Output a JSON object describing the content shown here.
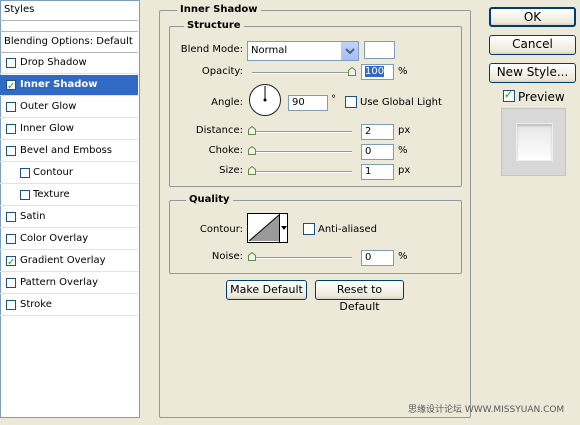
{
  "styles_panel": {
    "header": "Styles",
    "blending_options": "Blending Options: Default",
    "items": [
      {
        "label": "Drop Shadow",
        "checked": false
      },
      {
        "label": "Inner Shadow",
        "checked": true
      },
      {
        "label": "Outer Glow",
        "checked": false
      },
      {
        "label": "Inner Glow",
        "checked": false
      },
      {
        "label": "Bevel and Emboss",
        "checked": false
      },
      {
        "label": "Contour",
        "checked": false
      },
      {
        "label": "Texture",
        "checked": false
      },
      {
        "label": "Satin",
        "checked": false
      },
      {
        "label": "Color Overlay",
        "checked": false
      },
      {
        "label": "Gradient Overlay",
        "checked": true
      },
      {
        "label": "Pattern Overlay",
        "checked": false
      },
      {
        "label": "Stroke",
        "checked": false
      }
    ]
  },
  "inner_shadow": {
    "title": "Inner Shadow",
    "structure": {
      "title": "Structure",
      "blend_mode_label": "Blend Mode:",
      "blend_mode_value": "Normal",
      "opacity_label": "Opacity:",
      "opacity_value": "100",
      "opacity_unit": "%",
      "opacity_fraction": 1.0,
      "angle_label": "Angle:",
      "angle_value": "90",
      "angle_unit": "°",
      "use_global_light_label": "Use Global Light",
      "use_global_light_checked": false,
      "distance_label": "Distance:",
      "distance_value": "2",
      "distance_unit": "px",
      "distance_fraction": 0.0,
      "choke_label": "Choke:",
      "choke_value": "0",
      "choke_unit": "%",
      "choke_fraction": 0.0,
      "size_label": "Size:",
      "size_value": "1",
      "size_unit": "px",
      "size_fraction": 0.0
    },
    "quality": {
      "title": "Quality",
      "contour_label": "Contour:",
      "anti_aliased_label": "Anti-aliased",
      "anti_aliased_checked": false,
      "noise_label": "Noise:",
      "noise_value": "0",
      "noise_unit": "%",
      "noise_fraction": 0.0
    },
    "make_default_label": "Make Default",
    "reset_default_label": "Reset to Default"
  },
  "buttons": {
    "ok": "OK",
    "cancel": "Cancel",
    "new_style": "New Style...",
    "preview_label": "Preview",
    "preview_checked": true
  },
  "watermark": "思缘设计论坛 WWW.MISSYUAN.COM",
  "colors": {
    "selection": "#316ac5",
    "checkmark": "#21a121",
    "panel_bg": "#ece9d8"
  }
}
